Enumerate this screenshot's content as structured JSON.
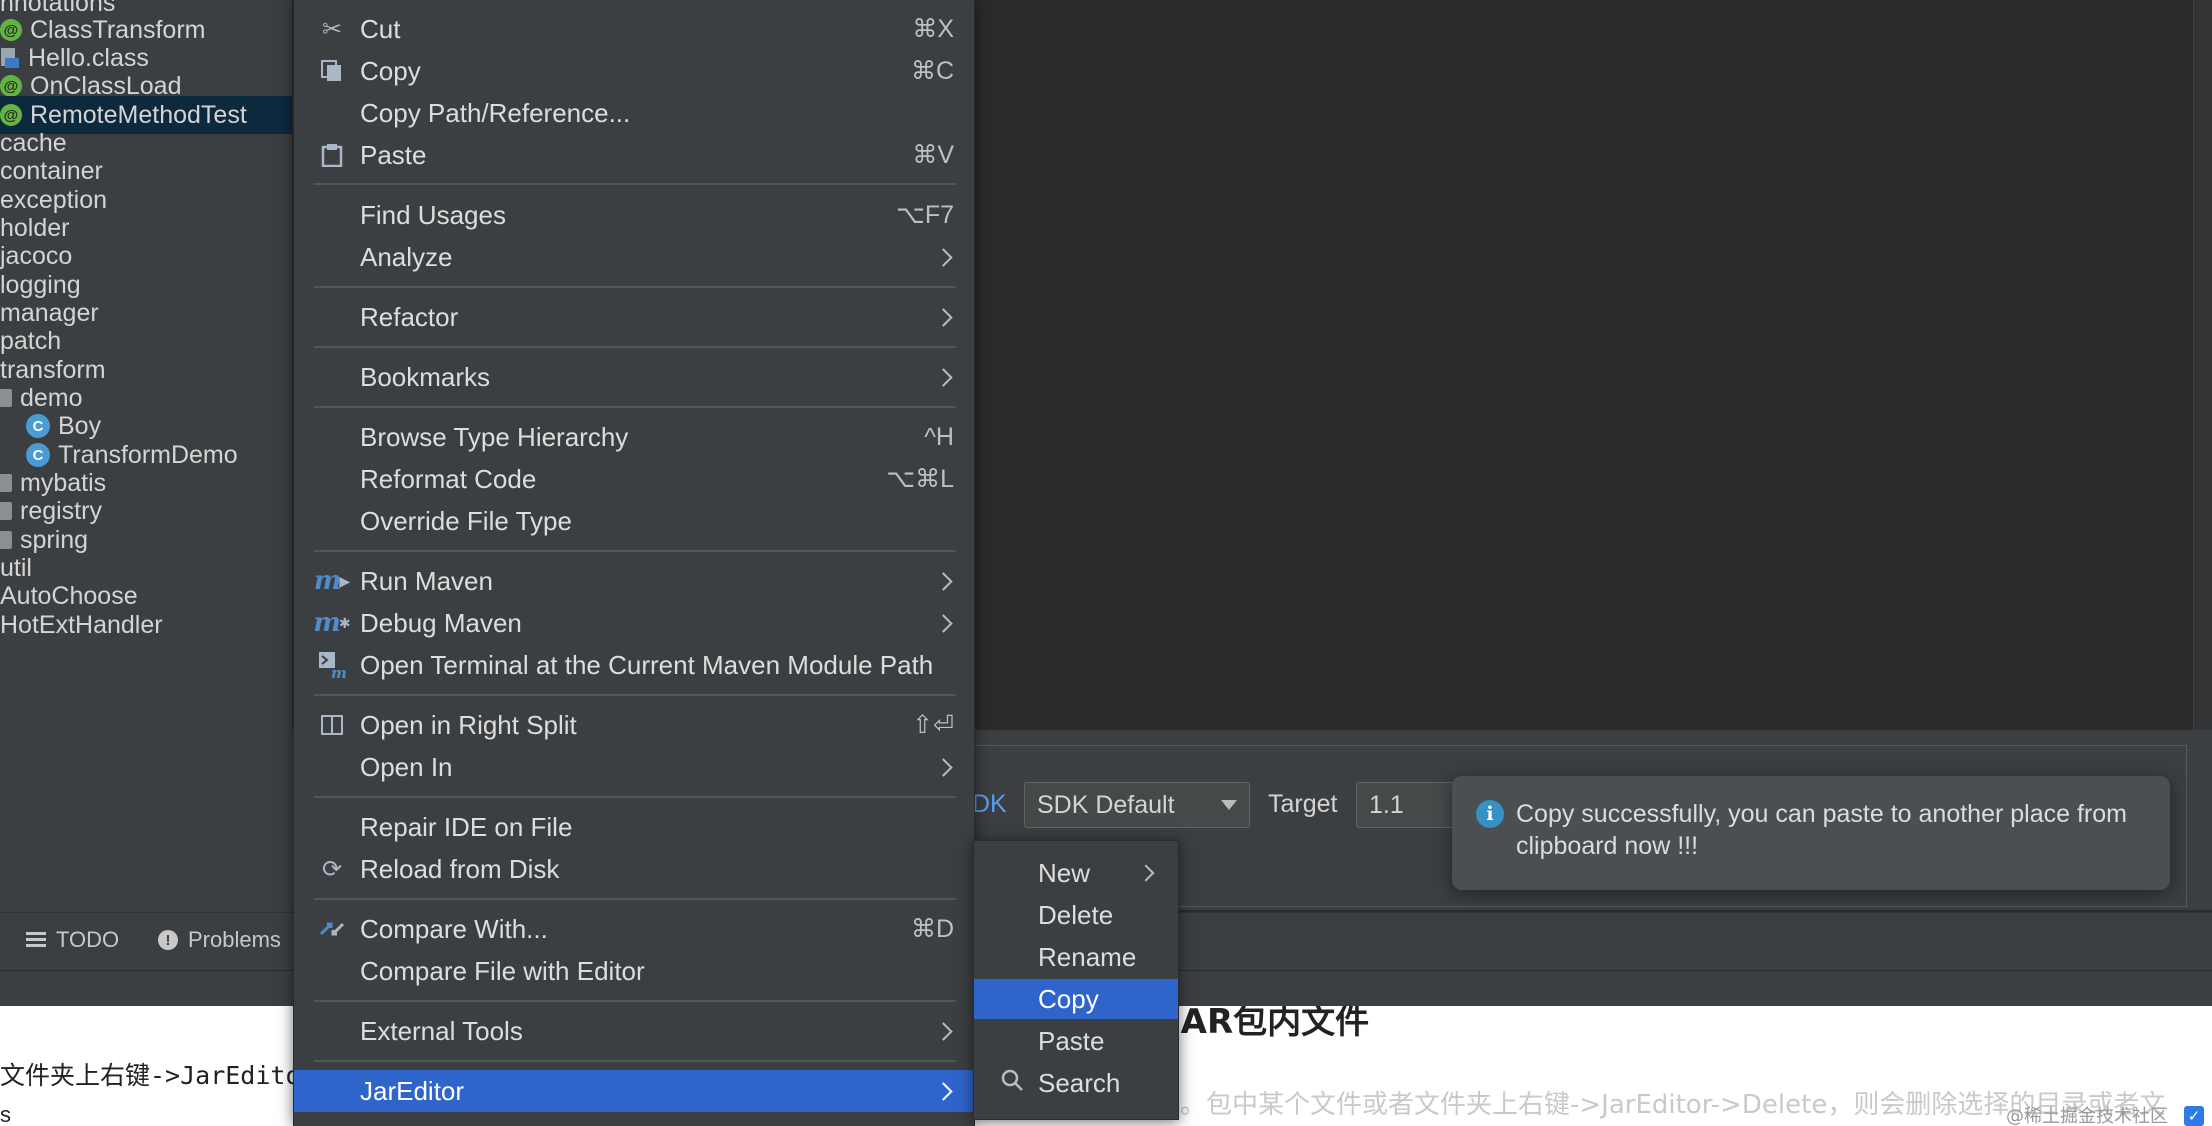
{
  "tree": {
    "items": [
      {
        "label": "nnotations",
        "icon": "none"
      },
      {
        "label": "ClassTransform",
        "icon": "annotation-icon"
      },
      {
        "label": "Hello.class",
        "icon": "class-file-icon"
      },
      {
        "label": "OnClassLoad",
        "icon": "annotation-icon"
      },
      {
        "label": "RemoteMethodTest",
        "icon": "annotation-icon",
        "selected": true
      },
      {
        "label": "cache",
        "icon": "none"
      },
      {
        "label": "container",
        "icon": "none"
      },
      {
        "label": "exception",
        "icon": "none"
      },
      {
        "label": "holder",
        "icon": "none"
      },
      {
        "label": "jacoco",
        "icon": "none"
      },
      {
        "label": "logging",
        "icon": "none"
      },
      {
        "label": "manager",
        "icon": "none"
      },
      {
        "label": "patch",
        "icon": "none"
      },
      {
        "label": "transform",
        "icon": "none"
      },
      {
        "label": "demo",
        "icon": "folder-icon"
      },
      {
        "label": "Boy",
        "icon": "class-icon"
      },
      {
        "label": "TransformDemo",
        "icon": "class-icon"
      },
      {
        "label": "mybatis",
        "icon": "folder-icon"
      },
      {
        "label": "registry",
        "icon": "folder-icon"
      },
      {
        "label": "spring",
        "icon": "folder-icon"
      },
      {
        "label": "util",
        "icon": "none"
      },
      {
        "label": "AutoChoose",
        "icon": "none"
      },
      {
        "label": "HotExtHandler",
        "icon": "none"
      }
    ]
  },
  "settings": {
    "sdk_label": "DK",
    "sdk_value": "SDK Default",
    "target_label": "Target",
    "target_value": "1.1"
  },
  "toast": {
    "icon": "info-icon",
    "message": "Copy successfully, you can paste to another place from clipboard now !!!"
  },
  "toolbar": {
    "todo_label": "TODO",
    "problems_label": "Problems"
  },
  "context_menu": {
    "items": [
      {
        "label": "Cut",
        "shortcut": "⌘X",
        "icon": "scissors-icon"
      },
      {
        "label": "Copy",
        "shortcut": "⌘C",
        "icon": "copy-icon"
      },
      {
        "label": "Copy Path/Reference...",
        "shortcut": "",
        "icon": "none"
      },
      {
        "label": "Paste",
        "shortcut": "⌘V",
        "icon": "paste-icon"
      },
      {
        "label": "Find Usages",
        "shortcut": "⌥F7",
        "icon": "none"
      },
      {
        "label": "Analyze",
        "shortcut": "",
        "icon": "none",
        "submenu": true
      },
      {
        "label": "Refactor",
        "shortcut": "",
        "icon": "none",
        "submenu": true
      },
      {
        "label": "Bookmarks",
        "shortcut": "",
        "icon": "none",
        "submenu": true
      },
      {
        "label": "Browse Type Hierarchy",
        "shortcut": "^H",
        "icon": "none"
      },
      {
        "label": "Reformat Code",
        "shortcut": "⌥⌘L",
        "icon": "none"
      },
      {
        "label": "Override File Type",
        "shortcut": "",
        "icon": "none"
      },
      {
        "label": "Run Maven",
        "shortcut": "",
        "icon": "maven-run-icon",
        "submenu": true
      },
      {
        "label": "Debug Maven",
        "shortcut": "",
        "icon": "maven-debug-icon",
        "submenu": true
      },
      {
        "label": "Open Terminal at the Current Maven Module Path",
        "shortcut": "",
        "icon": "terminal-maven-icon"
      },
      {
        "label": "Open in Right Split",
        "shortcut": "⇧⏎",
        "icon": "split-icon"
      },
      {
        "label": "Open In",
        "shortcut": "",
        "icon": "none",
        "submenu": true
      },
      {
        "label": "Repair IDE on File",
        "shortcut": "",
        "icon": "none"
      },
      {
        "label": "Reload from Disk",
        "shortcut": "",
        "icon": "reload-icon"
      },
      {
        "label": "Compare With...",
        "shortcut": "⌘D",
        "icon": "compare-icon"
      },
      {
        "label": "Compare File with Editor",
        "shortcut": "",
        "icon": "none"
      },
      {
        "label": "External Tools",
        "shortcut": "",
        "icon": "none",
        "submenu": true
      },
      {
        "label": "JarEditor",
        "shortcut": "",
        "icon": "none",
        "submenu": true,
        "active": true
      }
    ]
  },
  "submenu": {
    "items": [
      {
        "label": "New",
        "submenu": true
      },
      {
        "label": "Delete"
      },
      {
        "label": "Rename"
      },
      {
        "label": "Copy",
        "active": true
      },
      {
        "label": "Paste"
      },
      {
        "label": "Search",
        "icon": "search-icon"
      }
    ]
  },
  "article": {
    "heading": "JAR包内文件",
    "line1": "文件夹上右键->JarEdito",
    "line2": "s",
    "faint_text": "。包中某个文件或者文件夹上右键->JarEditor->Delete，则会删除选择的目录或者文",
    "watermark": "@稀土掘金技术社区"
  },
  "colors": {
    "menu_bg": "#3c3f41",
    "highlight": "#2f65ca",
    "editor_bg": "#2b2b2b",
    "selection": "#0d293e"
  }
}
